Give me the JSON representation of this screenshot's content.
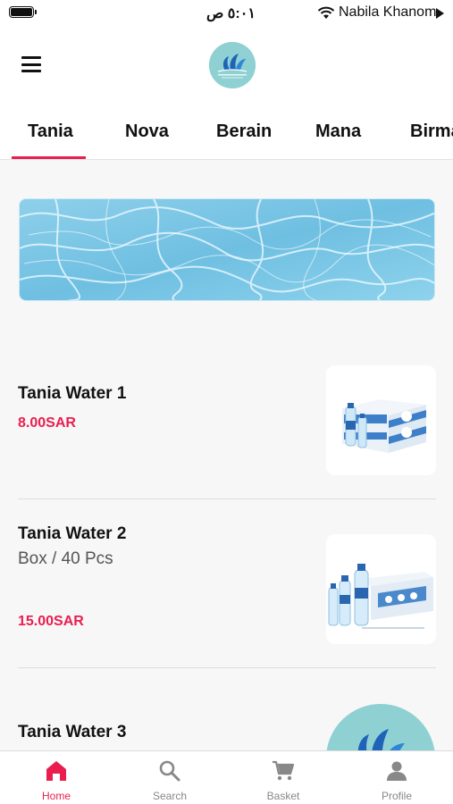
{
  "status_bar": {
    "time": "٥:٠١ ص",
    "carrier": "Nabila Khanom"
  },
  "brand_tabs": [
    "Tania",
    "Nova",
    "Berain",
    "Mana",
    "Birma"
  ],
  "active_tab": "Tania",
  "products": [
    {
      "name": "Tania Water 1",
      "description": "",
      "price": "8.00SAR"
    },
    {
      "name": "Tania Water 2",
      "description": "Box / 40 Pcs",
      "price": "15.00SAR"
    },
    {
      "name": "Tania Water 3",
      "description": "",
      "price": ""
    }
  ],
  "bottom_nav": [
    {
      "label": "Home",
      "icon": "home-icon",
      "active": true
    },
    {
      "label": "Search",
      "icon": "search-icon",
      "active": false
    },
    {
      "label": "Basket",
      "icon": "cart-icon",
      "active": false
    },
    {
      "label": "Profile",
      "icon": "person-icon",
      "active": false
    }
  ],
  "colors": {
    "accent": "#e91e4f",
    "logo_background": "#8fd1d3",
    "water": "#7cc4e2"
  }
}
